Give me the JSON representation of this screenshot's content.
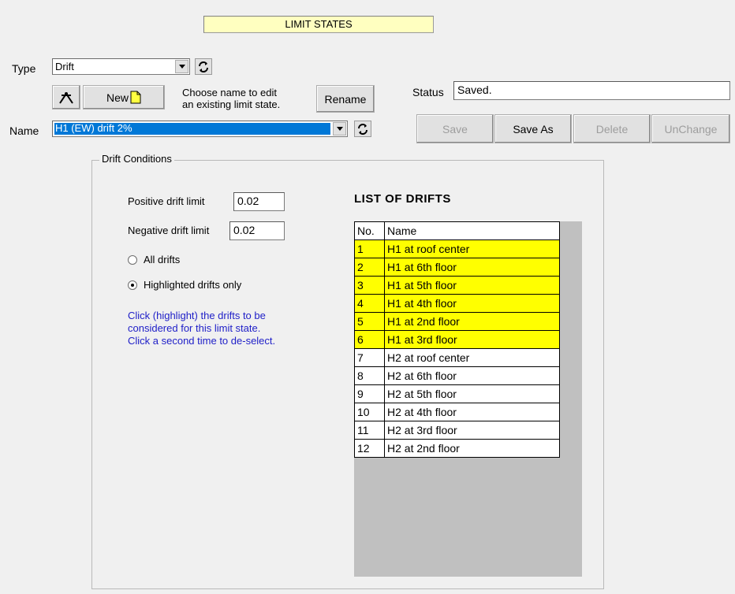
{
  "title": "LIMIT STATES",
  "type": {
    "label": "Type",
    "value": "Drift"
  },
  "toolbar": {
    "new_label": "New",
    "hint_line1": "Choose name to edit",
    "hint_line2": "an existing limit state.",
    "rename_label": "Rename"
  },
  "name": {
    "label": "Name",
    "value": "H1 (EW) drift 2%"
  },
  "status": {
    "label": "Status",
    "value": "Saved."
  },
  "actions": {
    "save": "Save",
    "save_as": "Save As",
    "delete": "Delete",
    "unchange": "UnChange"
  },
  "drift_conditions": {
    "title": "Drift Conditions",
    "positive_label": "Positive drift limit",
    "positive_value": "0.02",
    "negative_label": "Negative drift limit",
    "negative_value": "0.02",
    "all_drifts_label": "All drifts",
    "highlighted_label": "Highlighted drifts only",
    "selected_option": "highlighted",
    "help_line1": "Click (highlight) the drifts to be",
    "help_line2": "considered for this limit state.",
    "help_line3": "Click a second time to de-select."
  },
  "list": {
    "heading": "LIST OF DRIFTS",
    "columns": [
      "No.",
      "Name"
    ],
    "rows": [
      {
        "no": "1",
        "name": "H1 at roof center",
        "highlighted": true
      },
      {
        "no": "2",
        "name": "H1 at 6th floor",
        "highlighted": true
      },
      {
        "no": "3",
        "name": "H1 at 5th floor",
        "highlighted": true
      },
      {
        "no": "4",
        "name": "H1 at 4th floor",
        "highlighted": true
      },
      {
        "no": "5",
        "name": "H1 at 2nd floor",
        "highlighted": true
      },
      {
        "no": "6",
        "name": "H1 at 3rd floor",
        "highlighted": true
      },
      {
        "no": "7",
        "name": "H2 at roof center",
        "highlighted": false
      },
      {
        "no": "8",
        "name": "H2 at 6th floor",
        "highlighted": false
      },
      {
        "no": "9",
        "name": "H2 at 5th floor",
        "highlighted": false
      },
      {
        "no": "10",
        "name": "H2 at 4th floor",
        "highlighted": false
      },
      {
        "no": "11",
        "name": "H2 at 3rd floor",
        "highlighted": false
      },
      {
        "no": "12",
        "name": "H2 at 2nd floor",
        "highlighted": false
      }
    ]
  },
  "colors": {
    "highlight": "#ffff00",
    "title_bg": "#ffffc0",
    "selection": "#0078d7",
    "help_text": "#2020c8"
  }
}
